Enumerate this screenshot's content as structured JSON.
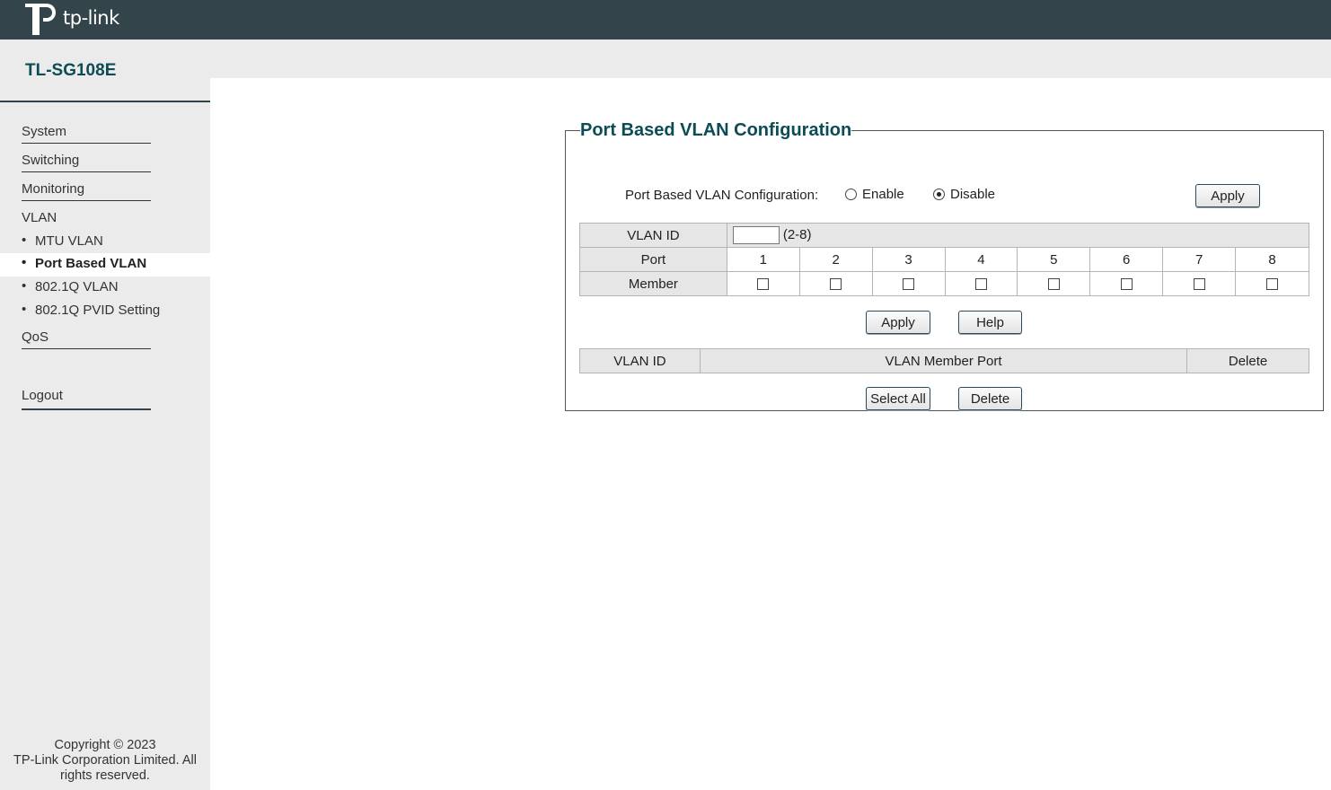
{
  "brand": {
    "logo_text": "tp-link",
    "model": "TL-SG108E"
  },
  "sidebar": {
    "items": [
      {
        "label": "System"
      },
      {
        "label": "Switching"
      },
      {
        "label": "Monitoring"
      },
      {
        "label": "VLAN"
      },
      {
        "label": "QoS"
      }
    ],
    "vlan_subitems": [
      {
        "label": "MTU VLAN",
        "active": false
      },
      {
        "label": "Port Based VLAN",
        "active": true
      },
      {
        "label": "802.1Q VLAN",
        "active": false
      },
      {
        "label": "802.1Q PVID Setting",
        "active": false
      }
    ],
    "bullet": "•",
    "logout": "Logout",
    "copyright_line1": "Copyright © 2023",
    "copyright_line2": "TP-Link Corporation Limited. All",
    "copyright_line3": "rights reserved."
  },
  "panel": {
    "title": "Port Based VLAN Configuration",
    "config_label": "Port Based VLAN Configuration:",
    "enable_label": "Enable",
    "disable_label": "Disable",
    "selected": "Disable",
    "apply_top": "Apply",
    "vlan_id_label": "VLAN ID",
    "vlan_id_value": "",
    "vlan_id_range": "(2-8)",
    "port_label": "Port",
    "ports": [
      "1",
      "2",
      "3",
      "4",
      "5",
      "6",
      "7",
      "8"
    ],
    "member_label": "Member",
    "apply_button": "Apply",
    "help_button": "Help",
    "table_headers": {
      "vlan_id": "VLAN ID",
      "member_port": "VLAN Member Port",
      "delete": "Delete"
    },
    "select_all_button": "Select All",
    "delete_button": "Delete"
  },
  "colors": {
    "topbar": "#33444a",
    "accent": "#0b4c55",
    "sidebar_bg": "#ebebeb"
  }
}
